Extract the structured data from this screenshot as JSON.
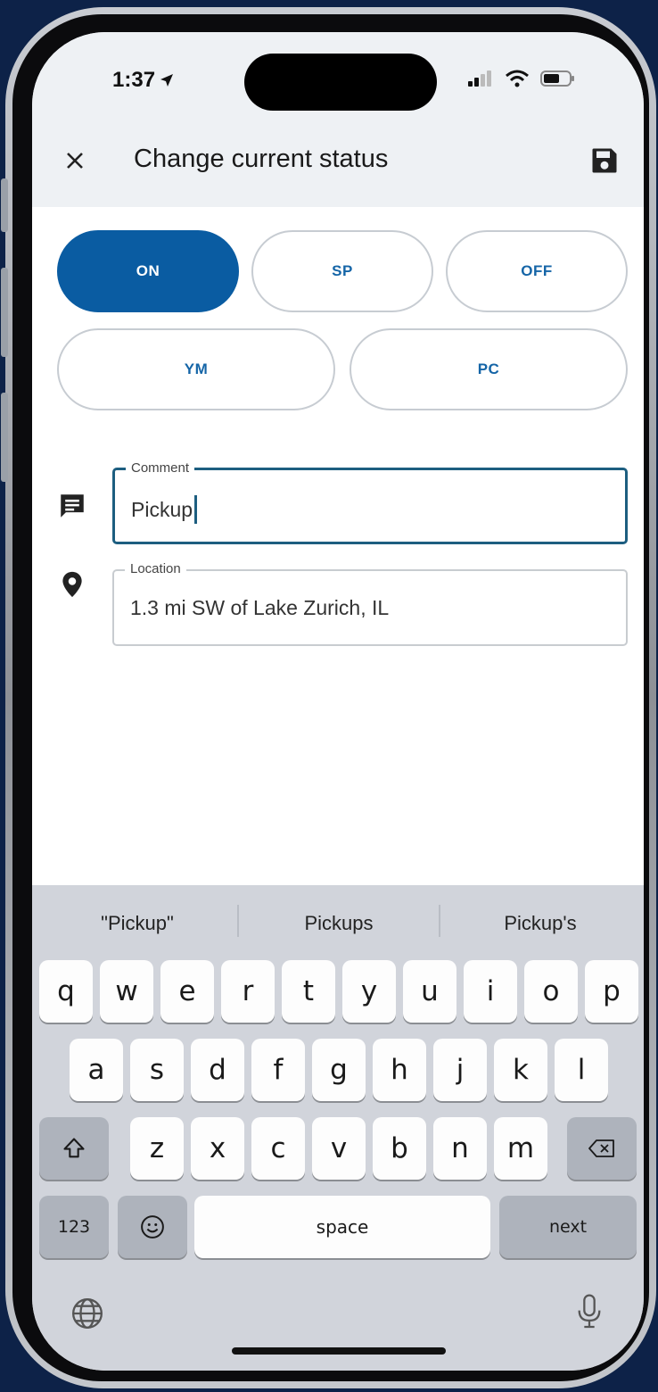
{
  "status_bar": {
    "time": "1:37"
  },
  "header": {
    "title": "Change current status"
  },
  "status_options": [
    "ON",
    "SP",
    "OFF",
    "YM",
    "PC"
  ],
  "selected_status": "ON",
  "comment": {
    "label": "Comment",
    "value": "Pickup"
  },
  "location": {
    "label": "Location",
    "value": "1.3 mi SW of Lake Zurich, IL"
  },
  "keyboard": {
    "suggestions": [
      "\"Pickup\"",
      "Pickups",
      "Pickup's"
    ],
    "rows": [
      [
        "q",
        "w",
        "e",
        "r",
        "t",
        "y",
        "u",
        "i",
        "o",
        "p"
      ],
      [
        "a",
        "s",
        "d",
        "f",
        "g",
        "h",
        "j",
        "k",
        "l"
      ],
      [
        "z",
        "x",
        "c",
        "v",
        "b",
        "n",
        "m"
      ]
    ],
    "numbers_key": "123",
    "space_key": "space",
    "return_key": "next"
  },
  "colors": {
    "background": "#0d2248",
    "accent": "#0a5ca2",
    "focus_border": "#1d5e80"
  },
  "icons": [
    "location-arrow-icon",
    "signal-icon",
    "wifi-icon",
    "battery-icon",
    "close-icon",
    "save-icon",
    "comment-icon",
    "location-pin-icon",
    "shift-icon",
    "backspace-icon",
    "emoji-icon",
    "globe-icon",
    "microphone-icon"
  ]
}
